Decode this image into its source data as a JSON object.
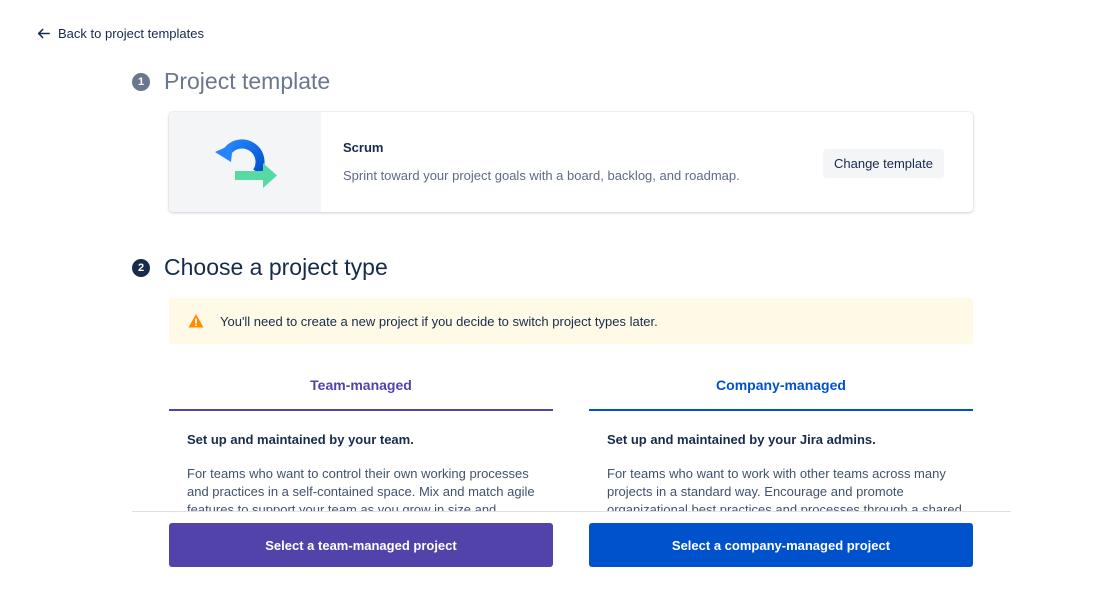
{
  "nav": {
    "back_label": "Back to project templates"
  },
  "step1": {
    "number": "1",
    "title": "Project template"
  },
  "template": {
    "name": "Scrum",
    "description": "Sprint toward your project goals with a board, backlog, and roadmap.",
    "change_label": "Change template",
    "icon": "scrum-icon"
  },
  "step2": {
    "number": "2",
    "title": "Choose a project type"
  },
  "warning": {
    "text": "You'll need to create a new project if you decide to switch project types later.",
    "icon": "warning-icon"
  },
  "team_managed": {
    "tab_label": "Team-managed",
    "heading": "Set up and maintained by your team.",
    "body": "For teams who want to control their own working processes and practices in a self-contained space. Mix and match agile features to support your team as you grow in size and",
    "button_label": "Select a team-managed project"
  },
  "company_managed": {
    "tab_label": "Company-managed",
    "heading": "Set up and maintained by your Jira admins.",
    "body": "For teams who want to work with other teams across many projects in a standard way. Encourage and promote organizational best practices and processes through a shared",
    "button_label": "Select a company-managed project"
  },
  "colors": {
    "team": "#5243aa",
    "company": "#0052cc",
    "warning": "#ff8b00"
  }
}
